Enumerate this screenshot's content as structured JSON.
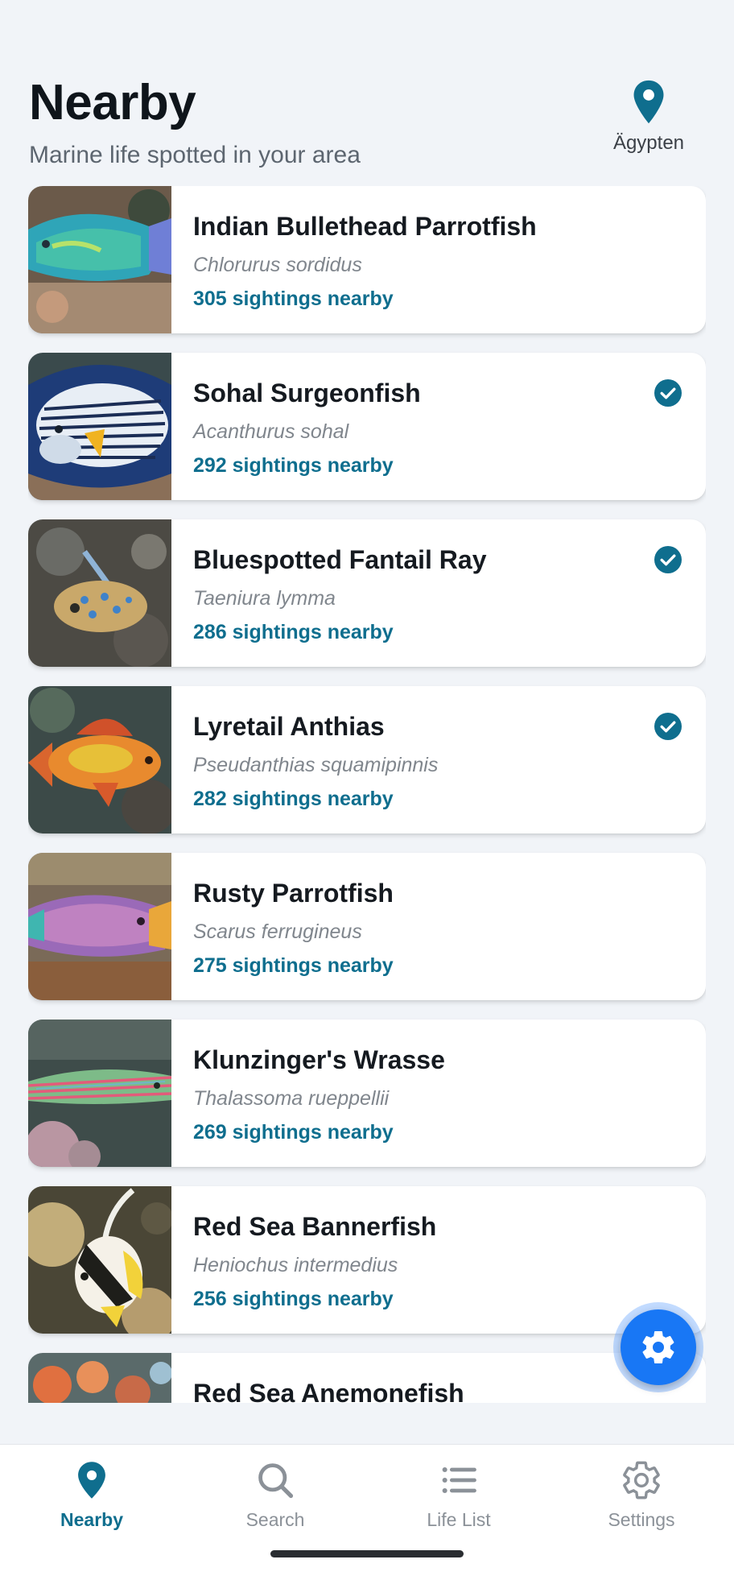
{
  "header": {
    "title": "Nearby",
    "subtitle": "Marine life spotted in your area",
    "location_label": "Ägypten",
    "location_icon": "map-pin-icon"
  },
  "species": [
    {
      "common_name": "Indian Bullethead Parrotfish",
      "scientific_name": "Chlorurus sordidus",
      "sightings": "305 sightings nearby",
      "on_life_list": false
    },
    {
      "common_name": "Sohal Surgeonfish",
      "scientific_name": "Acanthurus sohal",
      "sightings": "292 sightings nearby",
      "on_life_list": true
    },
    {
      "common_name": "Bluespotted Fantail Ray",
      "scientific_name": "Taeniura lymma",
      "sightings": "286 sightings nearby",
      "on_life_list": true
    },
    {
      "common_name": "Lyretail Anthias",
      "scientific_name": "Pseudanthias squamipinnis",
      "sightings": "282 sightings nearby",
      "on_life_list": true
    },
    {
      "common_name": "Rusty Parrotfish",
      "scientific_name": "Scarus ferrugineus",
      "sightings": "275 sightings nearby",
      "on_life_list": false
    },
    {
      "common_name": "Klunzinger's Wrasse",
      "scientific_name": "Thalassoma rueppellii",
      "sightings": "269 sightings nearby",
      "on_life_list": false
    },
    {
      "common_name": "Red Sea Bannerfish",
      "scientific_name": "Heniochus intermedius",
      "sightings": "256 sightings nearby",
      "on_life_list": false
    },
    {
      "common_name": "Red Sea Anemonefish",
      "scientific_name": "",
      "sightings": "",
      "on_life_list": false
    }
  ],
  "fab": {
    "icon": "gear-icon"
  },
  "nav": {
    "items": [
      {
        "label": "Nearby",
        "icon": "map-pin-icon",
        "active": true
      },
      {
        "label": "Search",
        "icon": "search-icon",
        "active": false
      },
      {
        "label": "Life List",
        "icon": "list-icon",
        "active": false
      },
      {
        "label": "Settings",
        "icon": "gear-icon",
        "active": false
      }
    ]
  },
  "colors": {
    "accent": "#0f6e8e",
    "fab": "#1877f5",
    "background": "#f1f4f8"
  }
}
